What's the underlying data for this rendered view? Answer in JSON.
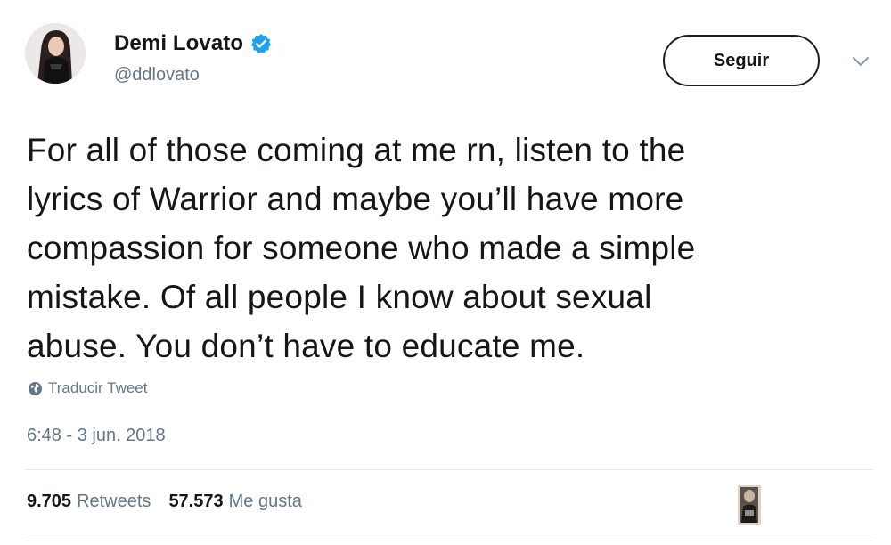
{
  "user": {
    "display_name": "Demi Lovato",
    "handle": "@ddlovato",
    "verified_icon": "verified-badge-icon",
    "accent_color": "#1da1f2"
  },
  "header": {
    "follow_label": "Seguir",
    "menu_icon": "chevron-down-icon"
  },
  "tweet": {
    "lines": [
      "For all of those coming at me rn, listen to the",
      "lyrics of Warrior and maybe you’ll have more",
      "compassion for someone who made a simple",
      "mistake. Of all people I know about sexual",
      "abuse. You don’t have to educate me."
    ],
    "translate_label": "Traducir Tweet",
    "translate_icon": "globe-icon",
    "timestamp": "6:48 - 3 jun. 2018"
  },
  "stats": {
    "retweets_count": "9.705",
    "retweets_label": "Retweets",
    "likes_count": "57.573",
    "likes_label": "Me gusta"
  },
  "colors": {
    "text": "#14171a",
    "secondary": "#657786",
    "divider": "#e1e8ed"
  }
}
